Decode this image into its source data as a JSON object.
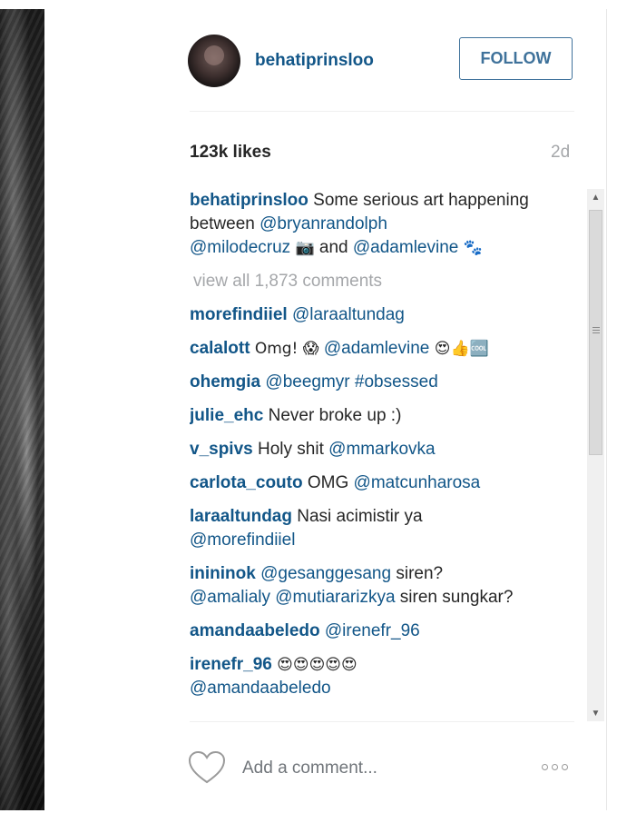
{
  "post": {
    "author": "behatiprinsloo",
    "follow_label": "FOLLOW",
    "likes": "123k likes",
    "age": "2d",
    "caption": {
      "user": "behatiprinsloo",
      "text": " Some serious art happening between ",
      "mention1": "@bryanrandolph",
      "mention2": "@milodecruz",
      "camera_emoji": "📷",
      "and_text": " and ",
      "mention3": "@adamlevine",
      "end_emoji": "🐾"
    },
    "view_all": "view all 1,873 comments"
  },
  "comments": [
    {
      "user": "morefindiiel",
      "text": "",
      "mention": "@laraaltundag",
      "after": ""
    },
    {
      "user": "calalott",
      "text": "Omg! 😱 ",
      "mention": "@adamlevine",
      "after": " 😍👍🆒"
    },
    {
      "user": "ohemgia",
      "text": "",
      "mention": "@beegmyr #obsessed",
      "after": ""
    },
    {
      "user": "julie_ehc",
      "text": "Never broke up :)",
      "mention": "",
      "after": ""
    },
    {
      "user": "v_spivs",
      "text": "Holy shit ",
      "mention": "@mmarkovka",
      "after": ""
    },
    {
      "user": "carlota_couto",
      "text": "OMG ",
      "mention": "@matcunharosa",
      "after": ""
    },
    {
      "user": "laraaltundag",
      "text": "Nasi acimistir ya ",
      "mention": "@morefindiiel",
      "after": ""
    },
    {
      "user": "inininok",
      "text": "",
      "mention": "@gesanggesang",
      "after": " siren? ",
      "mention2": "@amalialy @mutiararizkya",
      "after2": " siren sungkar?"
    },
    {
      "user": "amandaabeledo",
      "text": "",
      "mention": "@irenefr_96",
      "after": ""
    },
    {
      "user": "irenefr_96",
      "text": "😍😍😍😍😍 ",
      "mention": "@amandaabeledo",
      "after": ""
    }
  ],
  "footer": {
    "add_comment_placeholder": "Add a comment...",
    "like_icon": "heart-outline-icon",
    "more_icon": "more-options-icon"
  },
  "colors": {
    "link": "#125688",
    "follow_border": "#3f729b",
    "muted": "#a5a7aa",
    "text": "#262626"
  }
}
